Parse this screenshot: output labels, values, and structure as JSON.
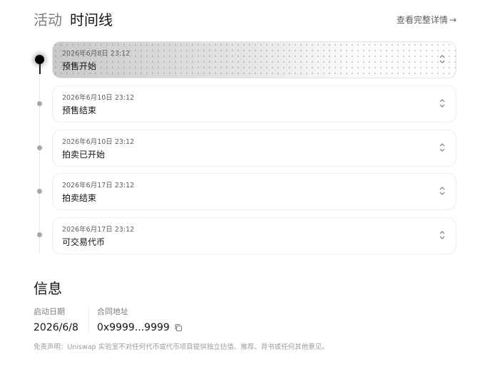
{
  "header": {
    "tab_activity": "活动",
    "tab_timeline": "时间线",
    "details_link": "查看完整详情",
    "details_arrow": "→"
  },
  "timeline": {
    "items": [
      {
        "date": "2026年6月8日 23:12",
        "title": "预售开始",
        "active": true
      },
      {
        "date": "2026年6月10日 23:12",
        "title": "预售结束",
        "active": false
      },
      {
        "date": "2026年6月10日 23:12",
        "title": "拍卖已开始",
        "active": false
      },
      {
        "date": "2026年6月17日 23:12",
        "title": "拍卖结束",
        "active": false
      },
      {
        "date": "2026年6月17日 23:12",
        "title": "可交易代币",
        "active": false
      }
    ]
  },
  "info": {
    "title": "信息",
    "launch_date_label": "启动日期",
    "launch_date_value": "2026/6/8",
    "contract_label": "合同地址",
    "contract_value": "0x9999...9999"
  },
  "disclaimer": "免责声明：Uniswap 实验室不对任何代币或代币项目提供独立估值、推荐、背书或任何其他意见。",
  "colors": {
    "text_primary": "#131313",
    "text_secondary": "#7d7d7d",
    "border": "#ececec",
    "dot": "#a7a7a7",
    "active_dot": "#000000"
  }
}
